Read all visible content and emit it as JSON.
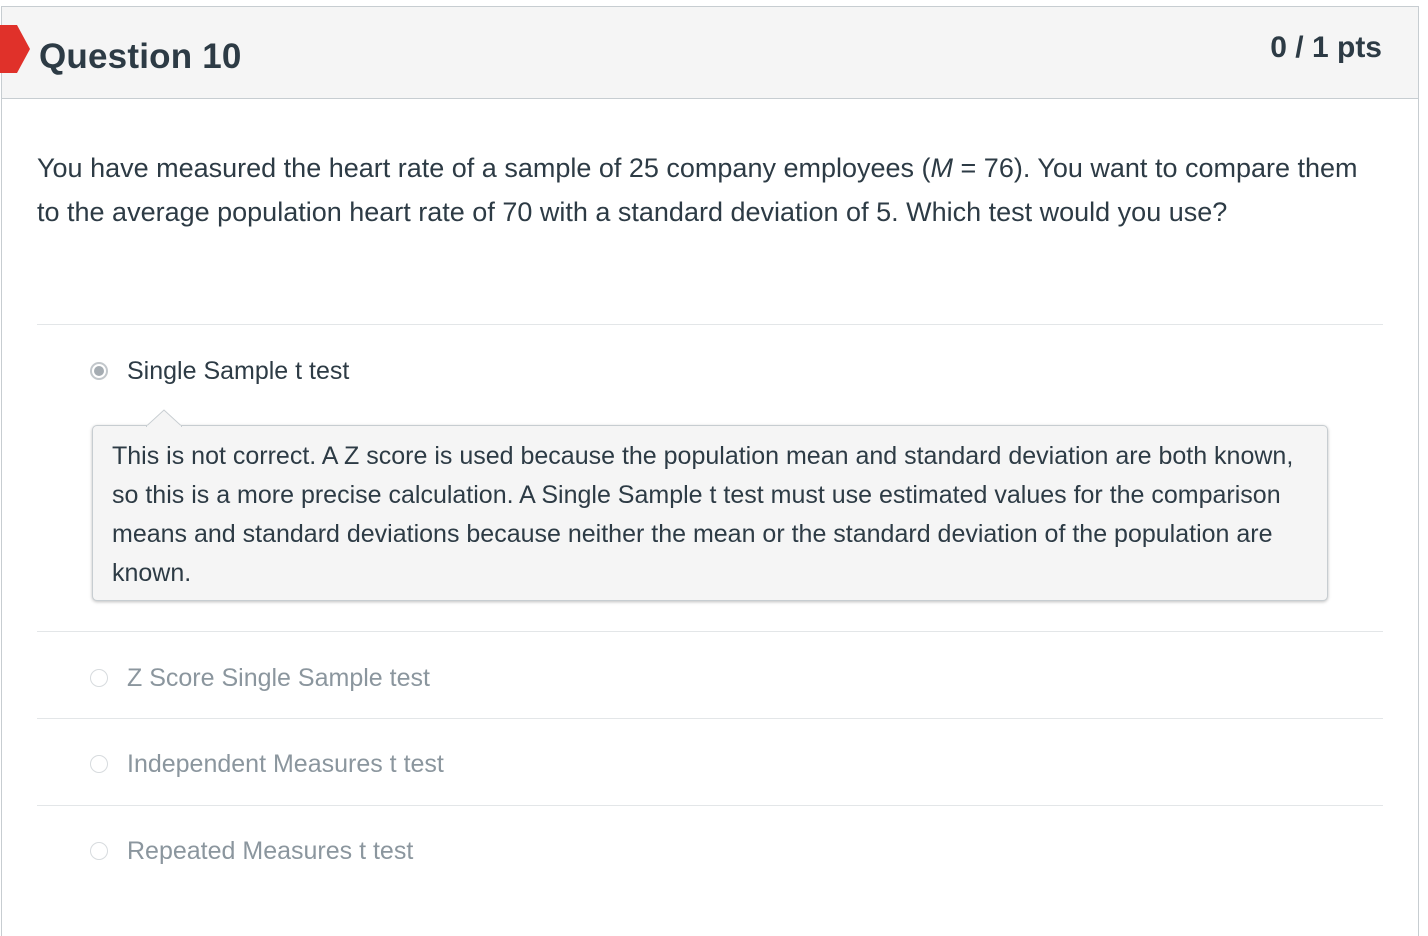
{
  "question": {
    "title": "Question 10",
    "points": "0 / 1 pts",
    "text_part1": "You have measured the heart rate of a sample of 25 company employees (",
    "text_italic": "M",
    "text_part2": " = 76). You want to compare them to the average population heart rate of 70 with a standard deviation of 5.   Which test would you use?"
  },
  "answers": [
    {
      "label": "Single Sample t test",
      "selected": true
    },
    {
      "label": "Z Score Single Sample test",
      "selected": false
    },
    {
      "label": "Independent Measures t test",
      "selected": false
    },
    {
      "label": "Repeated Measures t test",
      "selected": false
    }
  ],
  "feedback": {
    "text": "This is not correct. A Z score is used because the population mean and standard deviation are both known, so this is a more precise calculation. A Single Sample t test must use estimated values for the comparison means and standard deviations because neither the mean or the standard deviation of the population are known."
  },
  "colors": {
    "incorrect_flag": "#e0312a",
    "text": "#2d3b45",
    "muted_text": "#8b969e",
    "header_bg": "#f5f5f5",
    "border": "#c7cdd1"
  },
  "icons": {
    "incorrect_flag": "incorrect-answer-flag-icon"
  }
}
